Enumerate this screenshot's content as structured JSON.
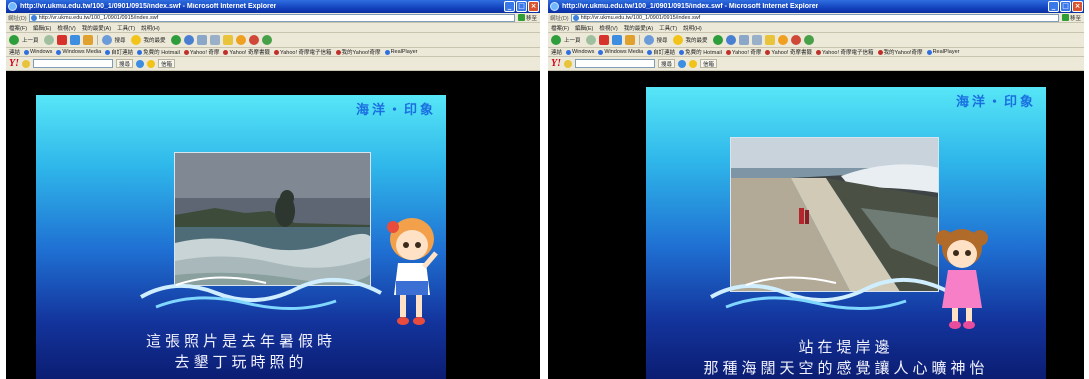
{
  "screens": [
    {
      "window_title": "http://vr.ukmu.edu.tw/100_1/0901/0915/index.swf - Microsoft Internet Explorer",
      "address_label": "網址(D)",
      "address": "http://vr.ukmu.edu.tw/100_1/0901/0915/index.swf",
      "go_label": "移至",
      "menu": [
        "檔案(F)",
        "編輯(E)",
        "檢視(V)",
        "我的最愛(A)",
        "工具(T)",
        "說明(H)"
      ],
      "toolbar": {
        "back": "上一頁",
        "search": "搜尋",
        "favorites": "我的最愛"
      },
      "links_label": "連結",
      "links": [
        "Windows",
        "Windows Media",
        "自訂連結",
        "免費的 Hotmail",
        "Yahoo! 奇摩",
        "Yahoo! 奇摩書籤",
        "Yahoo! 奇摩電子信箱",
        "我的Yahoo!奇摩",
        "RealPlayer"
      ],
      "yahoo": {
        "logo": "Y!",
        "search_btn": "搜尋",
        "mail": "信箱"
      },
      "stage_title": "海洋・印象",
      "caption_lines": [
        "這張照片是去年暑假時",
        "去墾丁玩時照的"
      ]
    },
    {
      "window_title": "http://vr.ukmu.edu.tw/100_1/0901/0915/index.swf - Microsoft Internet Explorer",
      "address_label": "網址(D)",
      "address": "http://vr.ukmu.edu.tw/100_1/0901/0915/index.swf",
      "go_label": "移至",
      "menu": [
        "檔案(F)",
        "編輯(E)",
        "檢視(V)",
        "我的最愛(A)",
        "工具(T)",
        "說明(H)"
      ],
      "toolbar": {
        "back": "上一頁",
        "search": "搜尋",
        "favorites": "我的最愛"
      },
      "links_label": "連結",
      "links": [
        "Windows",
        "Windows Media",
        "自訂連結",
        "免費的 Hotmail",
        "Yahoo! 奇摩",
        "Yahoo! 奇摩書籤",
        "Yahoo! 奇摩電子信箱",
        "我的Yahoo!奇摩",
        "RealPlayer"
      ],
      "yahoo": {
        "logo": "Y!",
        "search_btn": "搜尋",
        "mail": "信箱"
      },
      "stage_title": "海洋・印象",
      "caption_lines": [
        "站在堤岸邊",
        "那種海闊天空的感覺讓人心曠神怡"
      ]
    }
  ],
  "colors": {
    "titlebar": "#1443bf",
    "stage_top": "#57e6f7",
    "stage_bottom": "#0b1d72",
    "stage_title": "#1a6fe0"
  }
}
